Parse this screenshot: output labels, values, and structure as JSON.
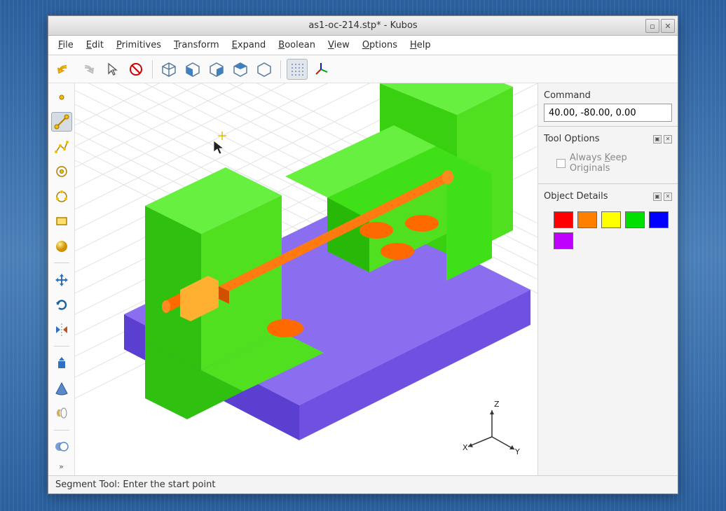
{
  "window": {
    "title": "as1-oc-214.stp* - Kubos"
  },
  "menubar": {
    "items": [
      {
        "label": "File",
        "u": "F"
      },
      {
        "label": "Edit",
        "u": "E"
      },
      {
        "label": "Primitives",
        "u": "P"
      },
      {
        "label": "Transform",
        "u": "T"
      },
      {
        "label": "Expand",
        "u": "E"
      },
      {
        "label": "Boolean",
        "u": "B"
      },
      {
        "label": "View",
        "u": "V"
      },
      {
        "label": "Options",
        "u": "O"
      },
      {
        "label": "Help",
        "u": "H"
      }
    ]
  },
  "toolbar": {
    "undo": "undo",
    "redo": "redo",
    "select": "select",
    "delete": "delete",
    "view_iso": "iso",
    "view_left": "left",
    "view_front": "front",
    "view_right": "right",
    "view_top": "top",
    "grid": "grid",
    "axes": "axes"
  },
  "left_tools": {
    "point": "point",
    "segment": "segment",
    "polyline": "polyline",
    "circle_center": "circle-center",
    "circle_3pt": "circle-3pt",
    "rect": "rect",
    "sphere": "sphere",
    "move": "move",
    "rotate": "rotate",
    "mirror": "mirror",
    "extrude": "extrude",
    "cone": "cone",
    "revolve": "revolve",
    "boolean": "boolean"
  },
  "right": {
    "command_label": "Command",
    "command_value": "40.00, -80.00, 0.00",
    "tool_options_label": "Tool Options",
    "always_keep_originals": "Always Keep Originals",
    "always_keep_originals_u": "K",
    "object_details_label": "Object Details",
    "colors": [
      "#ff0000",
      "#ff8000",
      "#ffff00",
      "#00e000",
      "#0000ff",
      "#c000ff"
    ]
  },
  "status": {
    "text": "Segment Tool: Enter the start point"
  },
  "axes": {
    "x": "X",
    "y": "Y",
    "z": "Z"
  }
}
